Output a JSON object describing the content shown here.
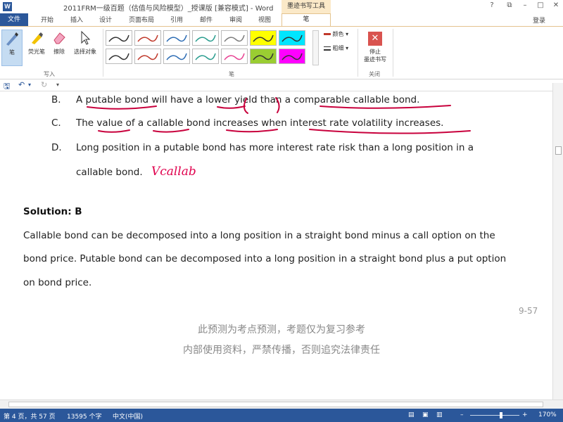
{
  "titlebar": {
    "title": "2011FRM一级百题（估值与风险模型）_授课版 [兼容模式] - Word",
    "context_tab": "墨迹书写工具",
    "help": "?",
    "restore": "⧉",
    "minimize": "–",
    "maximize": "□",
    "close": "✕"
  },
  "tabs": {
    "file": "文件",
    "items": [
      "开始",
      "插入",
      "设计",
      "页面布局",
      "引用",
      "邮件",
      "审阅",
      "视图"
    ],
    "pen": "笔",
    "login": "登录"
  },
  "ribbon": {
    "tools": {
      "pen": "笔",
      "highlighter": "荧光笔",
      "eraser": "擦除",
      "select": "选择对象"
    },
    "group_write": "写入",
    "group_pens": "笔",
    "group_close": "关闭",
    "color_label": "颜色",
    "thickness_label": "粗细",
    "stop_label_line1": "停止",
    "stop_label_line2": "墨迹书写",
    "pen_colors": [
      "#333333",
      "#c0392b",
      "#2e6db4",
      "#2a9d8f",
      "#7d7d7d",
      "#ffff00",
      "#00e5ff",
      "#333333",
      "#c0392b",
      "#2e6db4",
      "#2a9d8f",
      "#e84393",
      "#9acd32",
      "#ff00ff"
    ]
  },
  "document": {
    "options": [
      {
        "letter": "B.",
        "text": "A putable bond will have a lower yield than a comparable callable bond."
      },
      {
        "letter": "C.",
        "text": "The value of a callable bond increases when interest rate volatility increases."
      },
      {
        "letter": "D.",
        "text": "Long position in a putable bond has more interest rate risk than a long position in a"
      },
      {
        "letter": "",
        "text": "callable bond."
      }
    ],
    "ink_note": "Vcallab",
    "solution": "Solution: B",
    "explanation": [
      "Callable bond can be decomposed into a long position in a straight bond minus a call option on the",
      "bond price. Putable bond can be decomposed into a long position in a straight bond plus a put option",
      "on bond price."
    ],
    "page_number": "9-57",
    "watermark_line1": "此预测为考点预测，考题仅为复习参考",
    "watermark_line2": "内部使用资料，严禁传播，否则追究法律责任"
  },
  "statusbar": {
    "page": "第 4 页，共 57 页",
    "words": "13595 个字",
    "language": "中文(中国)",
    "zoom": "170%"
  }
}
